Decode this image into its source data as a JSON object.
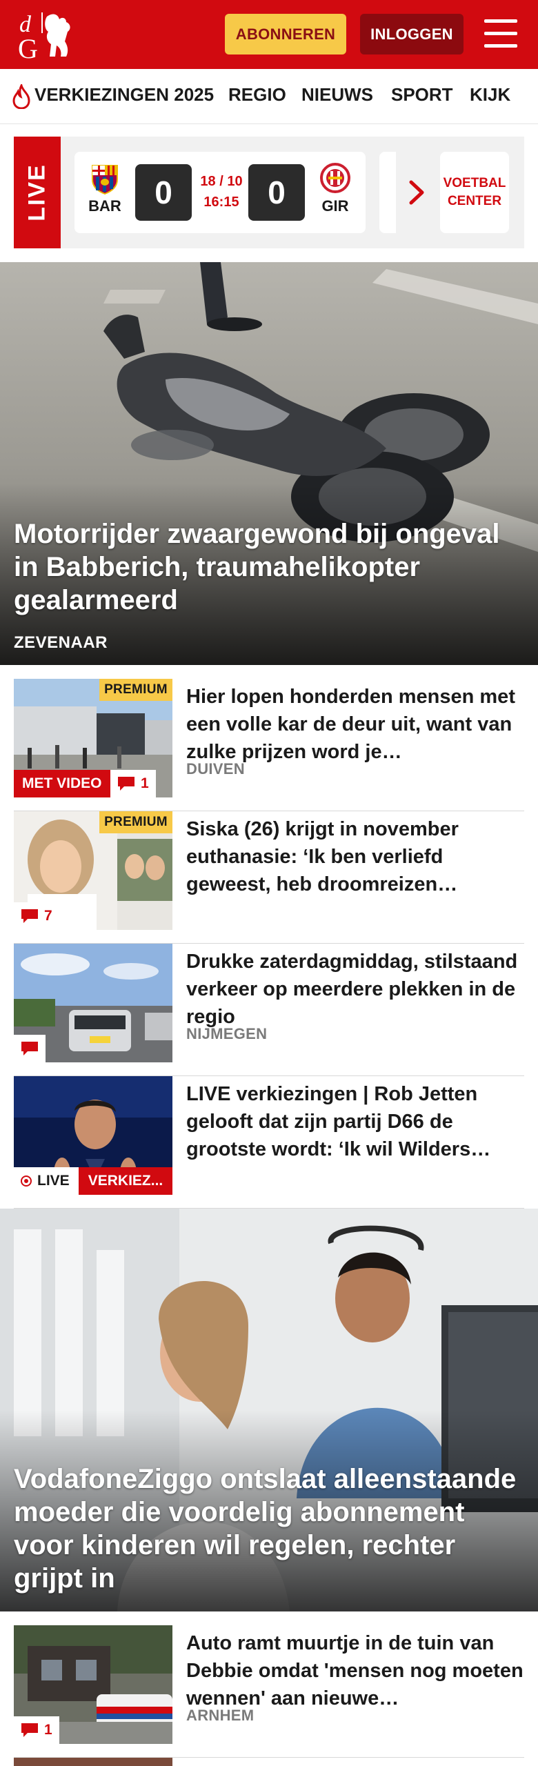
{
  "header": {
    "logo_letters": "dG",
    "subscribe_label": "ABONNEREN",
    "login_label": "INLOGGEN",
    "colors": {
      "brand": "#d10a10",
      "subscribe_bg": "#f7c948",
      "login_bg": "#8c0a0f"
    }
  },
  "nav": {
    "items": [
      "VERKIEZINGEN 2025",
      "REGIO",
      "NIEUWS",
      "SPORT",
      "KIJK"
    ]
  },
  "live": {
    "label": "LIVE",
    "match": {
      "home": "BAR",
      "away": "GIR",
      "home_score": "0",
      "away_score": "0",
      "date": "18 / 10",
      "time": "16:15"
    },
    "football_center_line1": "VOETBAL",
    "football_center_line2": "CENTER"
  },
  "hero1": {
    "title": "Motorrijder zwaargewond bij ongeval in Babberich, traumahelikopter gealarmeerd",
    "location": "ZEVENAAR"
  },
  "articles": [
    {
      "title": "Hier lopen honderden mensen met een volle kar de deur uit, want van zulke prijzen word je…",
      "location": "DUIVEN",
      "premium": "PREMIUM",
      "video": "MET VIDEO",
      "comments": "1"
    },
    {
      "title": "Siska (26) krijgt in november euthanasie: ‘Ik ben verliefd geweest, heb droomreizen…",
      "premium": "PREMIUM",
      "comments": "7"
    },
    {
      "title": "Drukke zaterdagmiddag, stilstaand verkeer op meerdere plekken in de regio",
      "location": "NIJMEGEN"
    },
    {
      "title": "LIVE verkiezingen | Rob Jetten gelooft dat zijn partij D66 de grootste wordt: ‘Ik wil Wilders…",
      "live": "LIVE",
      "category": "VERKIEZ..."
    }
  ],
  "hero2": {
    "title": "VodafoneZiggo ontslaat alleenstaan­de moeder die voordelig abonnement voor kinderen wil regelen, rechter grijpt in"
  },
  "article5": {
    "title": "Auto ramt muurtje in de tuin van Debbie omdat 'mensen nog moeten wennen' aan nieuwe…",
    "location": "ARNHEM",
    "comments": "1"
  }
}
